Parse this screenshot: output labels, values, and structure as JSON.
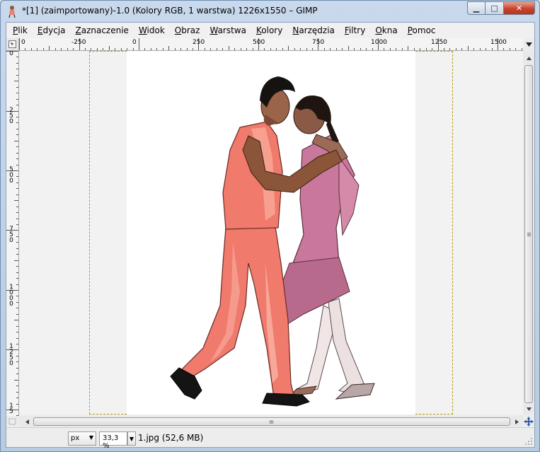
{
  "window": {
    "title": "*[1] (zaimportowany)-1.0 (Kolory RGB, 1 warstwa) 1226x1550 – GIMP",
    "minimize_glyph": "▁",
    "maximize_glyph": "□",
    "close_glyph": "✕"
  },
  "menu": [
    "Plik",
    "Edycja",
    "Zaznaczenie",
    "Widok",
    "Obraz",
    "Warstwa",
    "Kolory",
    "Narzędzia",
    "Filtry",
    "Okna",
    "Pomoc"
  ],
  "hruler": {
    "labels": [
      "0",
      "-250",
      "0",
      "250",
      "500",
      "750",
      "1000",
      "1250",
      "1500"
    ]
  },
  "vruler": {
    "labels": [
      "0",
      "2\n5\n0",
      "5\n0\n0",
      "7\n5\n0",
      "1\n0\n0\n0",
      "1\n2\n5\n0",
      "1\n5"
    ]
  },
  "statusbar": {
    "unit": "px",
    "zoom": "33,3 %",
    "info": "1.jpg (52,6 MB)"
  },
  "icons": {
    "corner": "pointer-corner-icon",
    "navigate": "navigate-icon",
    "zoom_fit": "zoom-toggle-icon"
  },
  "colors": {
    "selection_border": "#b89a10",
    "canvas_bg": "#f2f2f2",
    "man_outfit": "#f07a6c",
    "woman_dress": "#c9789c"
  }
}
